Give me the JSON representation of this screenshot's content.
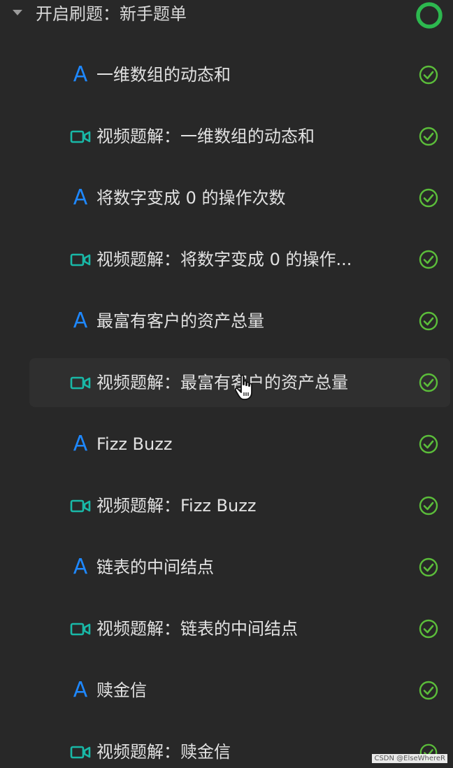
{
  "header": {
    "title": "开启刷题：新手题单",
    "progress_complete": true
  },
  "colors": {
    "background": "#282828",
    "article_icon": "#1e88ff",
    "video_icon": "#19b8a7",
    "check": "#5bbd3a",
    "ring": "#2db84f"
  },
  "items": [
    {
      "type": "article",
      "icon": "letter-a-icon",
      "label": "一维数组的动态和",
      "completed": true
    },
    {
      "type": "video",
      "icon": "video-camera-icon",
      "label": "视频题解：一维数组的动态和",
      "completed": true
    },
    {
      "type": "article",
      "icon": "letter-a-icon",
      "label": "将数字变成 0 的操作次数",
      "completed": true
    },
    {
      "type": "video",
      "icon": "video-camera-icon",
      "label": "视频题解：将数字变成 0 的操作...",
      "completed": true
    },
    {
      "type": "article",
      "icon": "letter-a-icon",
      "label": "最富有客户的资产总量",
      "completed": true
    },
    {
      "type": "video",
      "icon": "video-camera-icon",
      "label": "视频题解：最富有客户的资产总量",
      "completed": true,
      "hovered": true
    },
    {
      "type": "article",
      "icon": "letter-a-icon",
      "label": "Fizz Buzz",
      "completed": true
    },
    {
      "type": "video",
      "icon": "video-camera-icon",
      "label": "视频题解：Fizz Buzz",
      "completed": true
    },
    {
      "type": "article",
      "icon": "letter-a-icon",
      "label": "链表的中间结点",
      "completed": true
    },
    {
      "type": "video",
      "icon": "video-camera-icon",
      "label": "视频题解：链表的中间结点",
      "completed": true
    },
    {
      "type": "article",
      "icon": "letter-a-icon",
      "label": "赎金信",
      "completed": true
    },
    {
      "type": "video",
      "icon": "video-camera-icon",
      "label": "视频题解：赎金信",
      "completed": true
    }
  ],
  "watermark": "CSDN @ElseWhereR"
}
